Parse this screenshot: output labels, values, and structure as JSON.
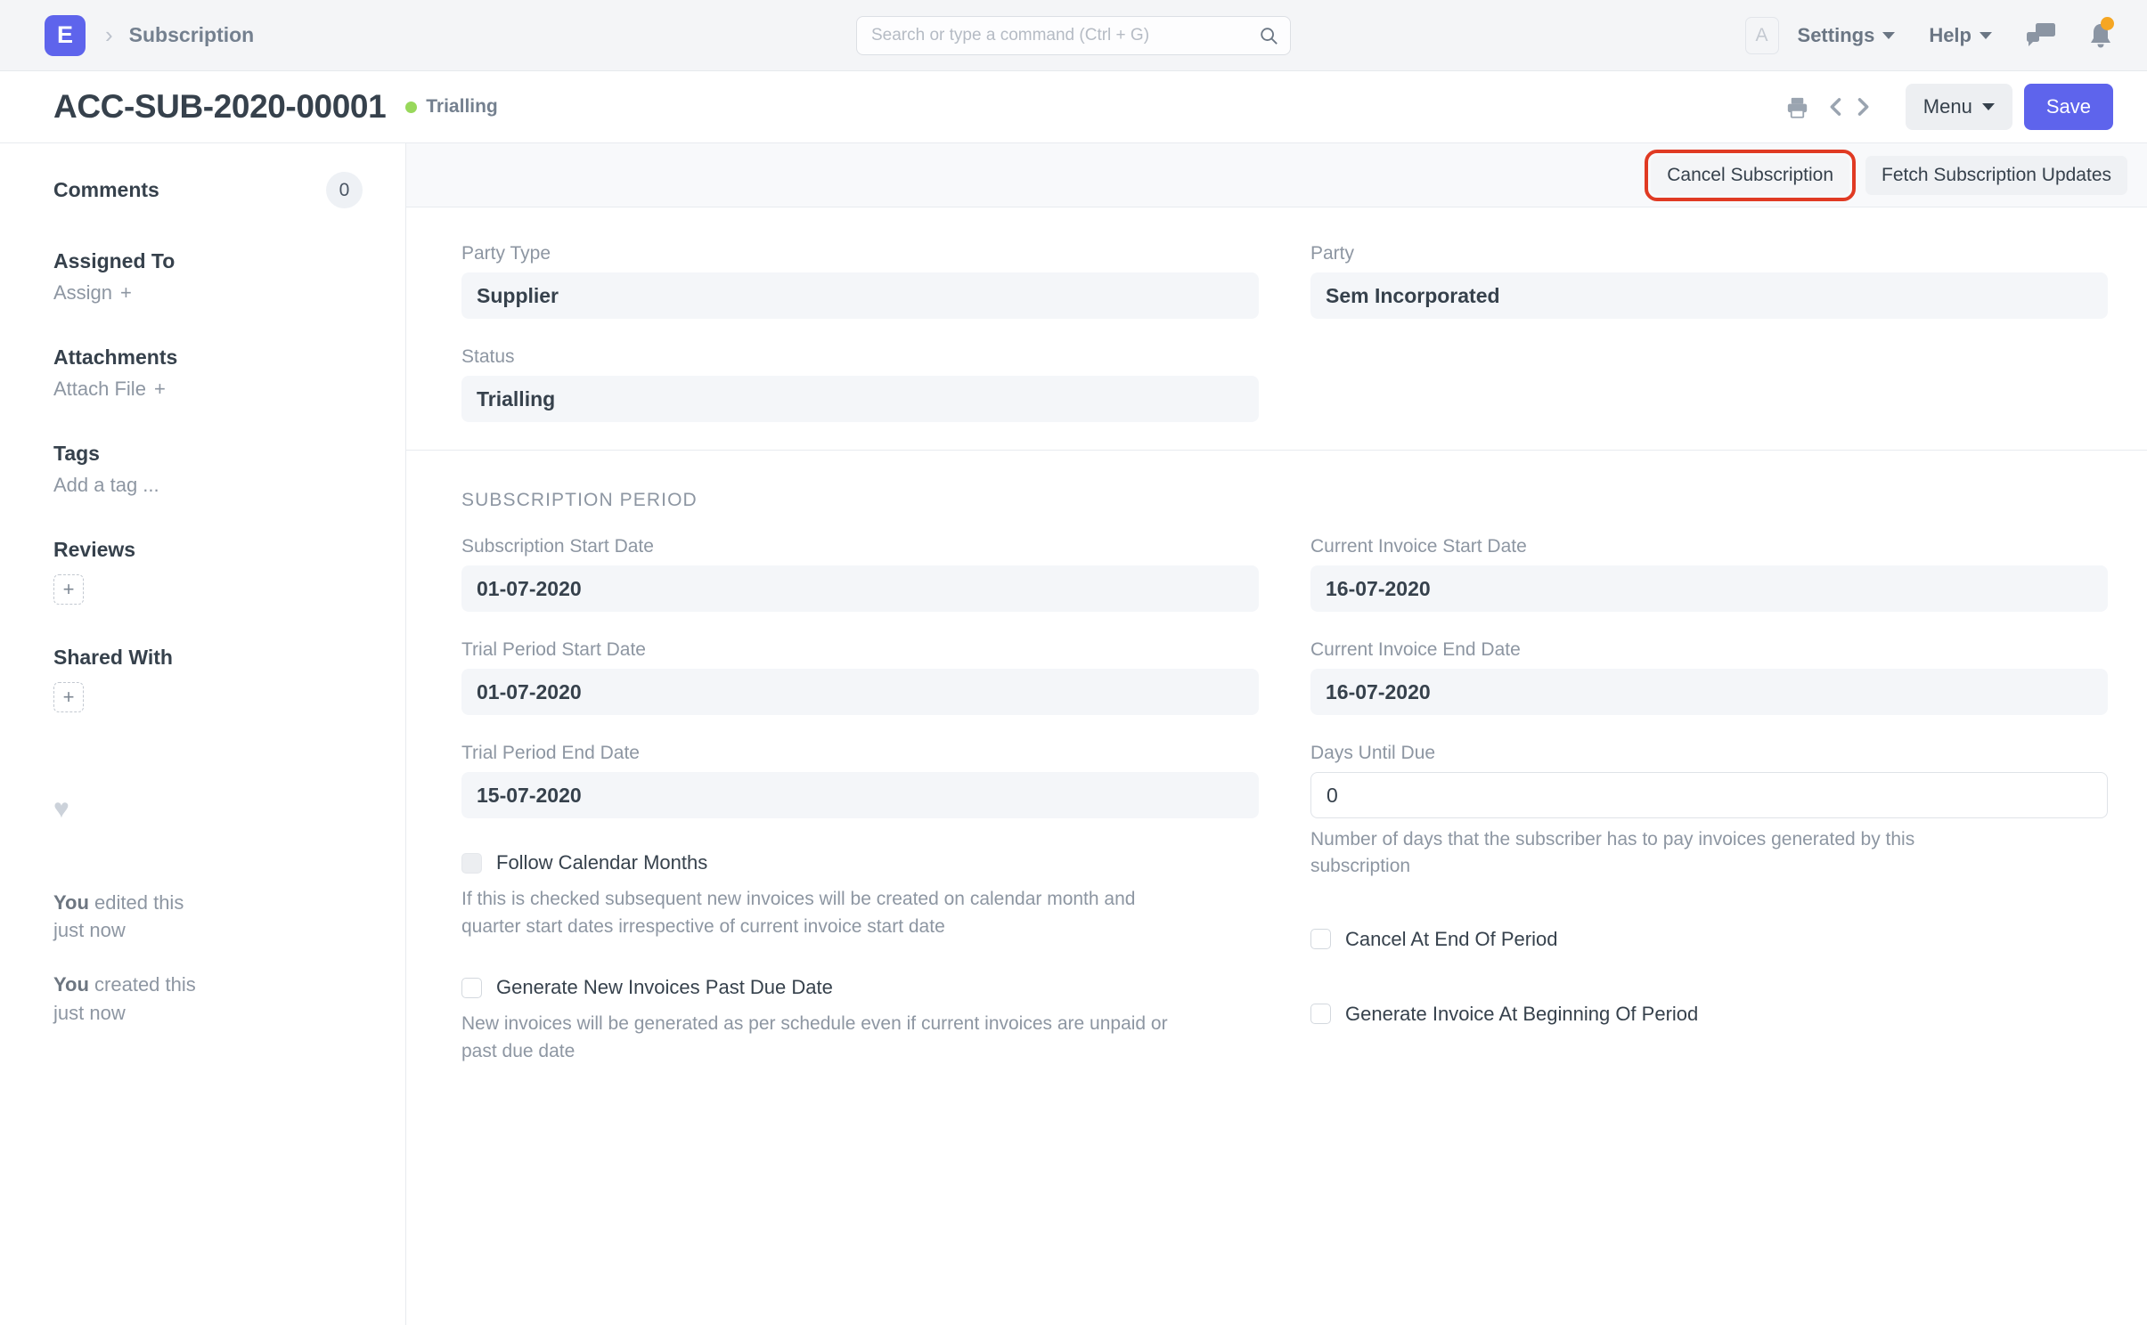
{
  "navbar": {
    "logo_letter": "E",
    "breadcrumb": "Subscription",
    "search_placeholder": "Search or type a command (Ctrl + G)",
    "search_value": "",
    "avatar_letter": "A",
    "settings_label": "Settings",
    "help_label": "Help",
    "icons": {
      "search": "search-icon",
      "chat": "chat-icon",
      "bell": "bell-icon"
    },
    "notification_dot_color": "#f5a623"
  },
  "page_header": {
    "title": "ACC-SUB-2020-00001",
    "status": "Trialling",
    "status_color": "#98d85b",
    "menu_label": "Menu",
    "save_label": "Save",
    "save_color": "#5e64ec"
  },
  "sidebar": {
    "comments_label": "Comments",
    "comments_count": "0",
    "assigned_to_label": "Assigned To",
    "assign_label": "Assign",
    "attachments_label": "Attachments",
    "attach_file_label": "Attach File",
    "tags_label": "Tags",
    "add_tag_label": "Add a tag ...",
    "reviews_label": "Reviews",
    "shared_with_label": "Shared With",
    "plus_glyph": "+",
    "heart_glyph": "♥",
    "activity": [
      {
        "actor": "You",
        "action": " edited this",
        "time": "just now"
      },
      {
        "actor": "You",
        "action": " created this",
        "time": "just now"
      }
    ]
  },
  "toolbar": {
    "cancel_subscription_label": "Cancel Subscription",
    "fetch_updates_label": "Fetch Subscription Updates",
    "highlight_color": "#e03a23"
  },
  "form": {
    "party_type_label": "Party Type",
    "party_type_value": "Supplier",
    "party_label": "Party",
    "party_value": "Sem Incorporated",
    "status_label": "Status",
    "status_value": "Trialling"
  },
  "subscription_period": {
    "section_title": "SUBSCRIPTION PERIOD",
    "subscription_start_date_label": "Subscription Start Date",
    "subscription_start_date_value": "01-07-2020",
    "trial_period_start_date_label": "Trial Period Start Date",
    "trial_period_start_date_value": "01-07-2020",
    "trial_period_end_date_label": "Trial Period End Date",
    "trial_period_end_date_value": "15-07-2020",
    "current_invoice_start_date_label": "Current Invoice Start Date",
    "current_invoice_start_date_value": "16-07-2020",
    "current_invoice_end_date_label": "Current Invoice End Date",
    "current_invoice_end_date_value": "16-07-2020",
    "days_until_due_label": "Days Until Due",
    "days_until_due_value": "0",
    "days_until_due_help": "Number of days that the subscriber has to pay invoices generated by this subscription",
    "follow_calendar_months_label": "Follow Calendar Months",
    "follow_calendar_months_help": "If this is checked subsequent new invoices will be created on calendar month and quarter start dates irrespective of current invoice start date",
    "generate_new_invoices_label": "Generate New Invoices Past Due Date",
    "generate_new_invoices_help": "New invoices will be generated as per schedule even if current invoices are unpaid or past due date",
    "cancel_at_end_label": "Cancel At End Of Period",
    "generate_invoice_beginning_label": "Generate Invoice At Beginning Of Period"
  }
}
